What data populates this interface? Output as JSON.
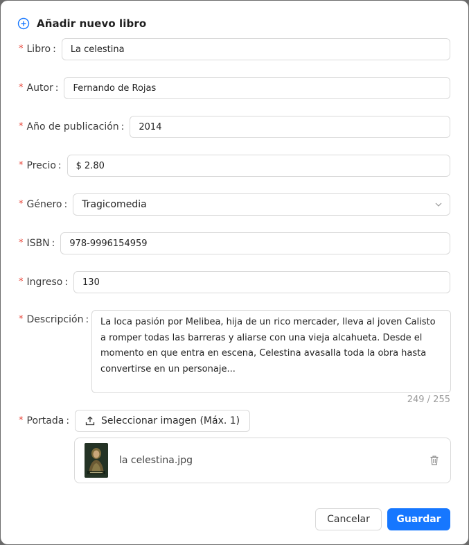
{
  "modal": {
    "title": "Añadir nuevo libro",
    "title_icon": "plus-circle-icon",
    "accent_color": "#1677ff",
    "required_color": "#e8463a"
  },
  "form": {
    "required_mark": "*",
    "libro": {
      "label": "Libro",
      "value": "La celestina"
    },
    "autor": {
      "label": "Autor",
      "value": "Fernando de Rojas"
    },
    "anio": {
      "label": "Año de publicación",
      "value": "2014"
    },
    "precio": {
      "label": "Precio",
      "prefix": "$",
      "value": "2.80"
    },
    "genero": {
      "label": "Género",
      "value": "Tragicomedia",
      "icon": "chevron-down-icon"
    },
    "isbn": {
      "label": "ISBN",
      "value": "978-9996154959"
    },
    "ingreso": {
      "label": "Ingreso",
      "value": "130"
    },
    "descripcion": {
      "label": "Descripción",
      "value": "La loca pasión por Melibea, hija de un rico mercader, lleva al joven Calisto a romper todas las barreras y aliarse con una vieja alcahueta. Desde el momento en que entra en escena, Celestina avasalla toda la obra hasta convertirse en un personaje...",
      "counter": "249 / 255"
    },
    "portada": {
      "label": "Portada",
      "button_label": "Seleccionar imagen (Máx. 1)",
      "button_icon": "upload-icon",
      "file_name": "la celestina.jpg",
      "delete_icon": "trash-icon"
    }
  },
  "footer": {
    "cancel_label": "Cancelar",
    "save_label": "Guardar"
  }
}
